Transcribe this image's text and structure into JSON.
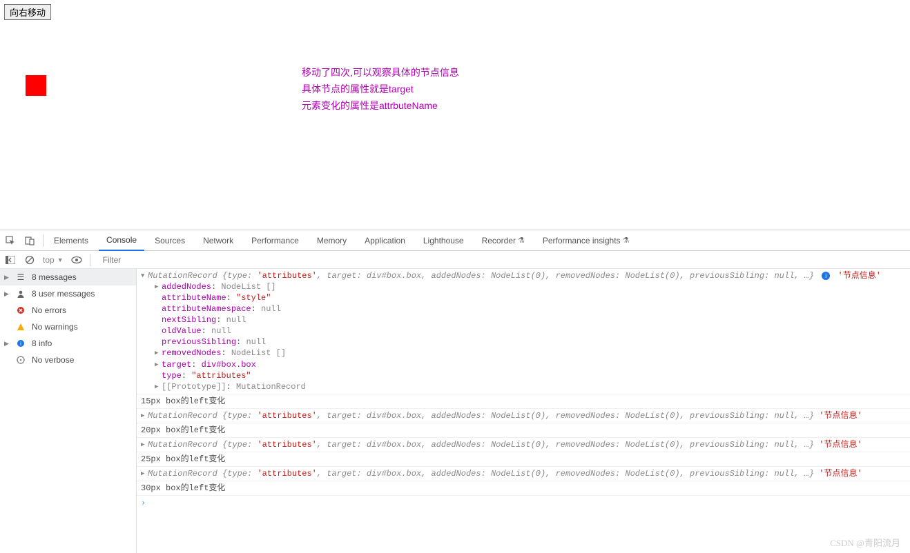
{
  "page": {
    "button_label": "向右移动",
    "annotation_line1": "移动了四次,可以观察具体的节点信息",
    "annotation_line2": "具体节点的属性就是target",
    "annotation_line3": "元素变化的属性是attrbuteName"
  },
  "devtools_tabs": {
    "elements": "Elements",
    "console": "Console",
    "sources": "Sources",
    "network": "Network",
    "performance": "Performance",
    "memory": "Memory",
    "application": "Application",
    "lighthouse": "Lighthouse",
    "recorder": "Recorder",
    "perf_insights": "Performance insights"
  },
  "console_toolbar": {
    "context": "top",
    "filter_placeholder": "Filter"
  },
  "sidebar": {
    "messages": "8 messages",
    "user_msgs": "8 user messages",
    "no_errors": "No errors",
    "no_warnings": "No warnings",
    "info": "8 info",
    "no_verbose": "No verbose"
  },
  "mutation": {
    "header_prefix": "MutationRecord ",
    "brace_open": "{",
    "type_key": "type",
    "type_val": "'attributes'",
    "target_key": "target",
    "target_val": "div#box.box",
    "added_key": "addedNodes",
    "added_val": "NodeList(0)",
    "removed_key": "removedNodes",
    "removed_val": "NodeList(0)",
    "prev_key": "previousSibling",
    "prev_val": "null",
    "ellipsis": "…",
    "brace_close": "}",
    "info_label": "'节点信息'"
  },
  "expanded": {
    "addedNodes": {
      "k": "addedNodes",
      "v": "NodeList []"
    },
    "attributeName": {
      "k": "attributeName",
      "v": "\"style\""
    },
    "attributeNamespace": {
      "k": "attributeNamespace",
      "v": "null"
    },
    "nextSibling": {
      "k": "nextSibling",
      "v": "null"
    },
    "oldValue": {
      "k": "oldValue",
      "v": "null"
    },
    "previousSibling": {
      "k": "previousSibling",
      "v": "null"
    },
    "removedNodes": {
      "k": "removedNodes",
      "v": "NodeList []"
    },
    "target": {
      "k": "target",
      "v": "div#box.box"
    },
    "type": {
      "k": "type",
      "v": "\"attributes\""
    },
    "proto": {
      "k": "[[Prototype]]",
      "v": "MutationRecord"
    }
  },
  "logs": {
    "l15": "15px box的left变化",
    "l20": "20px box的left变化",
    "l25": "25px box的left变化",
    "l30": "30px box的left变化"
  },
  "watermark": "CSDN @青阳流月",
  "separators": {
    "comma": ", ",
    "colon": ": "
  }
}
